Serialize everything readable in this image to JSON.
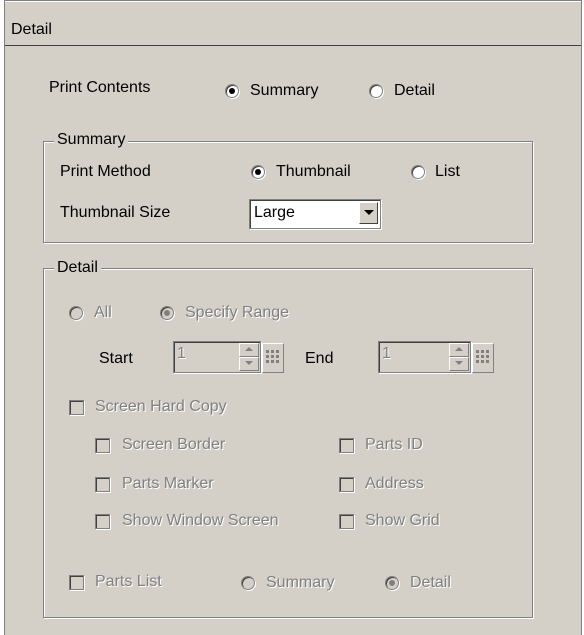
{
  "panel": {
    "title": "Detail"
  },
  "print_contents": {
    "label": "Print Contents",
    "options": [
      {
        "label": "Summary",
        "checked": true
      },
      {
        "label": "Detail",
        "checked": false
      }
    ]
  },
  "summary_group": {
    "legend": "Summary",
    "print_method": {
      "label": "Print Method",
      "options": [
        {
          "label": "Thumbnail",
          "checked": true
        },
        {
          "label": "List",
          "checked": false
        }
      ]
    },
    "thumbnail_size": {
      "label": "Thumbnail Size",
      "value": "Large"
    }
  },
  "detail_group": {
    "legend": "Detail",
    "range_options": [
      {
        "label": "All",
        "checked": false
      },
      {
        "label": "Specify Range",
        "checked": true
      }
    ],
    "start": {
      "label": "Start",
      "value": "1"
    },
    "end": {
      "label": "End",
      "value": "1"
    },
    "screen_hard_copy": {
      "label": "Screen Hard Copy",
      "options": [
        {
          "label": "Screen Border"
        },
        {
          "label": "Parts ID"
        },
        {
          "label": "Parts Marker"
        },
        {
          "label": "Address"
        },
        {
          "label": "Show Window Screen"
        },
        {
          "label": "Show Grid"
        }
      ]
    },
    "parts_list": {
      "label": "Parts List",
      "options": [
        {
          "label": "Summary",
          "checked": false
        },
        {
          "label": "Detail",
          "checked": true
        }
      ]
    }
  }
}
